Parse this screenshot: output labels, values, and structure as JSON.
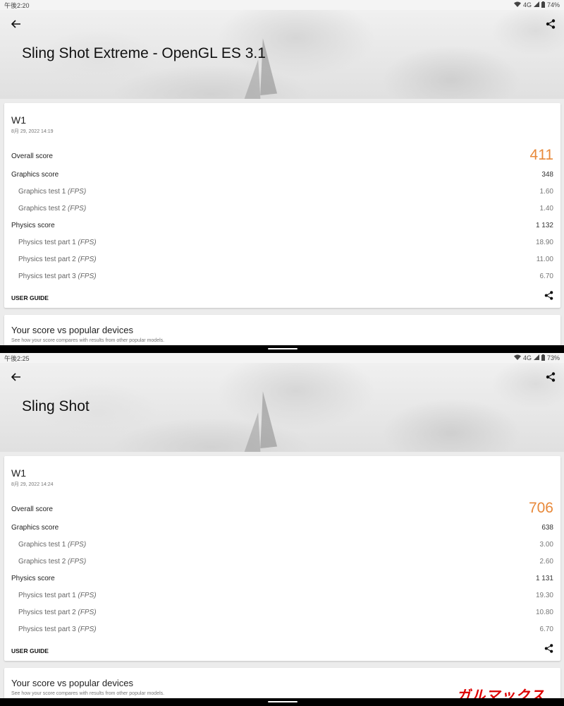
{
  "screens": [
    {
      "status": {
        "time": "午後2:20",
        "signal": "4G",
        "battery": "74%"
      },
      "title": "Sling Shot Extreme - OpenGL ES 3.1",
      "result": {
        "device": "W1",
        "date": "8月 29, 2022 14:19",
        "overall_label": "Overall score",
        "overall_value": "411",
        "graphics_label": "Graphics score",
        "graphics_value": "348",
        "gt1_label": "Graphics test 1",
        "gt1_value": "1.60",
        "gt2_label": "Graphics test 2",
        "gt2_value": "1.40",
        "physics_label": "Physics score",
        "physics_value": "1 132",
        "pt1_label": "Physics test part 1",
        "pt1_value": "18.90",
        "pt2_label": "Physics test part 2",
        "pt2_value": "11.00",
        "pt3_label": "Physics test part 3",
        "pt3_value": "6.70",
        "unit": "(FPS)",
        "user_guide": "USER GUIDE"
      },
      "compare": {
        "title": "Your score vs popular devices",
        "subtitle": "See how your score compares with results from other popular models."
      }
    },
    {
      "status": {
        "time": "午後2:25",
        "signal": "4G",
        "battery": "73%"
      },
      "title": "Sling Shot",
      "result": {
        "device": "W1",
        "date": "8月 29, 2022 14:24",
        "overall_label": "Overall score",
        "overall_value": "706",
        "graphics_label": "Graphics score",
        "graphics_value": "638",
        "gt1_label": "Graphics test 1",
        "gt1_value": "3.00",
        "gt2_label": "Graphics test 2",
        "gt2_value": "2.60",
        "physics_label": "Physics score",
        "physics_value": "1 131",
        "pt1_label": "Physics test part 1",
        "pt1_value": "19.30",
        "pt2_label": "Physics test part 2",
        "pt2_value": "10.80",
        "pt3_label": "Physics test part 3",
        "pt3_value": "6.70",
        "unit": "(FPS)",
        "user_guide": "USER GUIDE"
      },
      "compare": {
        "title": "Your score vs popular devices",
        "subtitle": "See how your score compares with results from other popular models."
      }
    }
  ],
  "watermark": "ガルマックス",
  "colors": {
    "accent_score": "#e8893a"
  }
}
